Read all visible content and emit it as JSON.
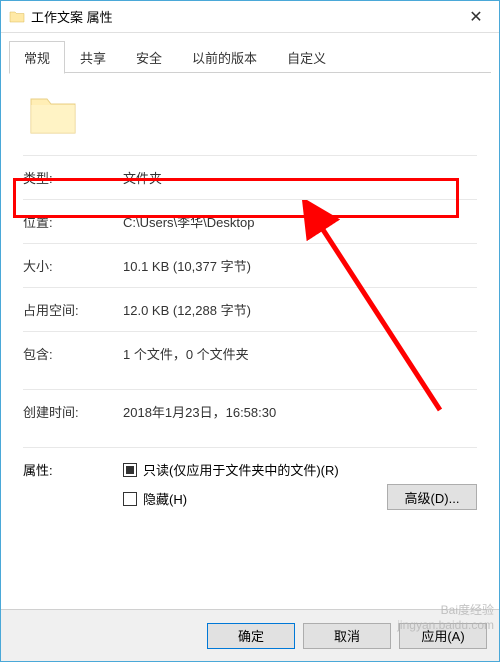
{
  "titlebar": {
    "title": "工作文案 属性",
    "close_glyph": "✕"
  },
  "tabs": {
    "general": "常规",
    "share": "共享",
    "security": "安全",
    "previous": "以前的版本",
    "custom": "自定义"
  },
  "rows": {
    "type_label": "类型:",
    "type_value": "文件夹",
    "location_label": "位置:",
    "location_value": "C:\\Users\\李华\\Desktop",
    "size_label": "大小:",
    "size_value": "10.1 KB (10,377 字节)",
    "ondisk_label": "占用空间:",
    "ondisk_value": "12.0 KB (12,288 字节)",
    "contains_label": "包含:",
    "contains_value": "1 个文件，0 个文件夹",
    "created_label": "创建时间:",
    "created_value": "2018年1月23日，16:58:30",
    "attr_label": "属性:",
    "readonly_label": "只读(仅应用于文件夹中的文件)(R)",
    "hidden_label": "隐藏(H)",
    "advanced_btn": "高级(D)..."
  },
  "footer": {
    "ok": "确定",
    "cancel": "取消",
    "apply": "应用(A)"
  },
  "watermark": {
    "line1": "Bai度经验",
    "line2": "jingyan.baidu.com"
  },
  "colors": {
    "accent": "#4aa8d8",
    "highlight": "#ff0000"
  }
}
